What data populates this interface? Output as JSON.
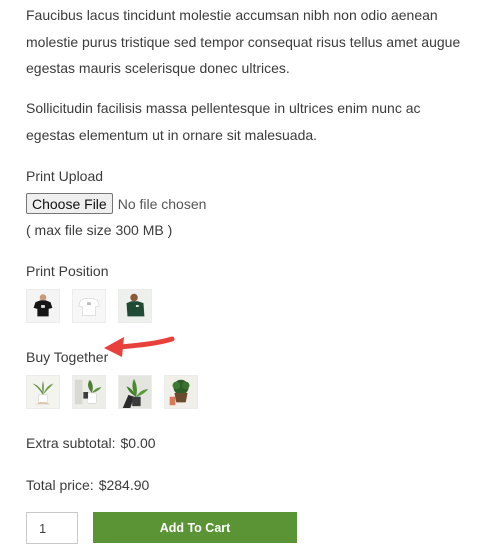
{
  "description": {
    "paragraph_1": "Faucibus lacus tincidunt molestie accumsan nibh non odio aenean molestie purus tristique sed tempor consequat risus tellus amet augue egestas mauris scelerisque donec ultrices.",
    "paragraph_2": "Sollicitudin facilisis massa pellentesque in ultrices enim nunc ac egestas elementum ut in ornare sit malesuada."
  },
  "print_upload": {
    "label": "Print Upload",
    "button_label": "Choose File",
    "status": "No file chosen",
    "note": "( max file size 300 MB )"
  },
  "print_position": {
    "label": "Print Position",
    "options": [
      {
        "icon": "tshirt-front-black-icon"
      },
      {
        "icon": "tshirt-white-icon"
      },
      {
        "icon": "tshirt-green-icon"
      }
    ]
  },
  "buy_together": {
    "label": "Buy Together",
    "items": [
      {
        "icon": "plant-pot-icon"
      },
      {
        "icon": "plant-vase-icon"
      },
      {
        "icon": "plant-leaves-icon"
      },
      {
        "icon": "plant-basket-icon"
      }
    ]
  },
  "pricing": {
    "extra_label": "Extra subtotal:",
    "extra_value": "$0.00",
    "total_label": "Total price:",
    "total_value": "$284.90"
  },
  "cart": {
    "quantity": "1",
    "button_label": "Add To Cart"
  },
  "colors": {
    "accent": "#5a9435",
    "annotation_arrow": "#e8413c"
  }
}
